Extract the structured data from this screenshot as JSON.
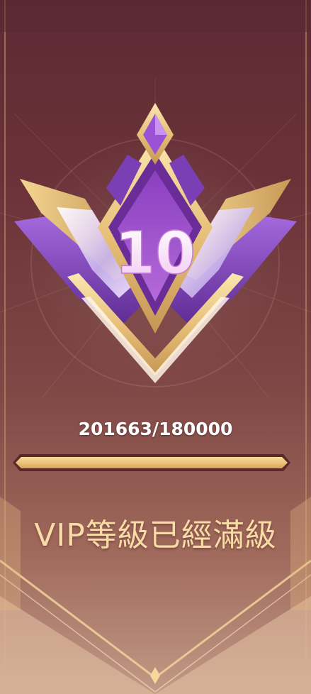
{
  "vip": {
    "level": "10",
    "progress_text": "201663/180000",
    "progress_fraction": 1.0,
    "status_text": "VIP等級已經滿級"
  },
  "colors": {
    "gold": "#e8c27a",
    "purple": "#7b3fb0",
    "background": "#6a3238",
    "status_text": "#f7dca6"
  },
  "icons": {
    "badge": "vip-crown-badge-icon",
    "gem": "diamond-gem-icon"
  }
}
